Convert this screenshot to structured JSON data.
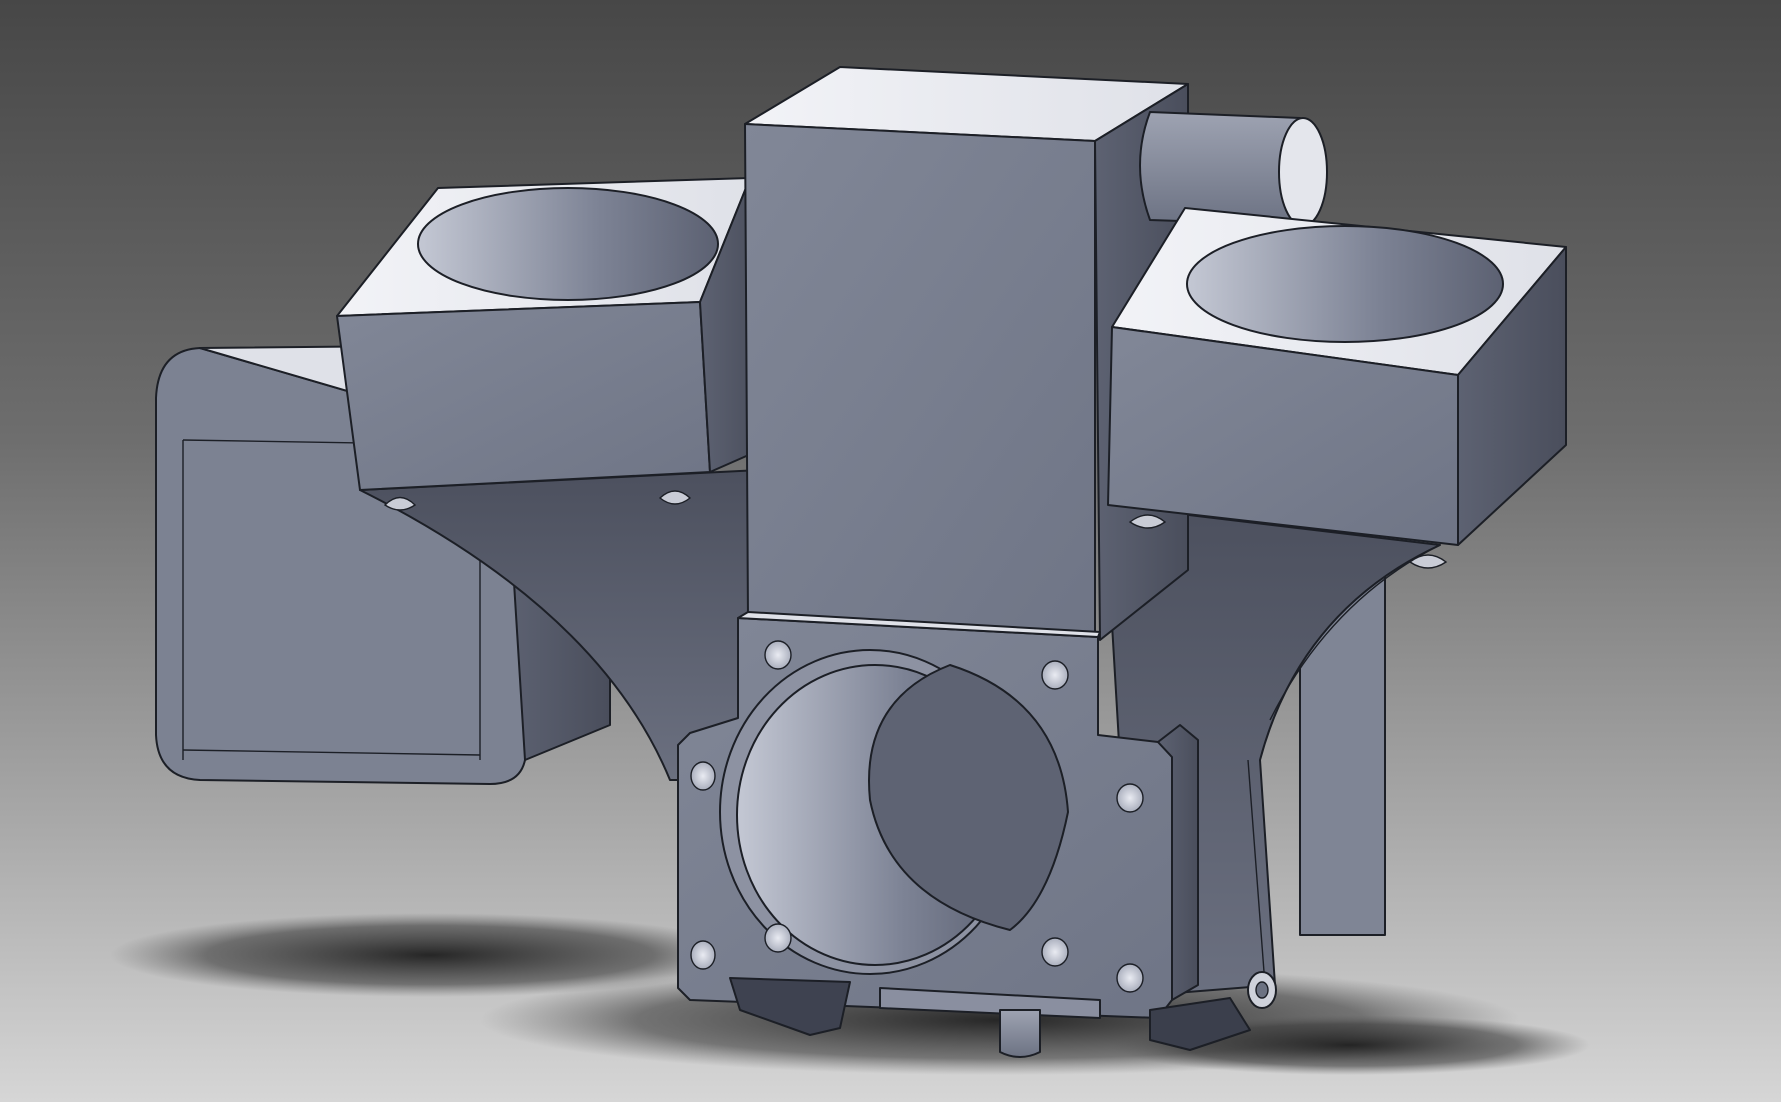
{
  "viewport": {
    "background_top": "#474747",
    "background_bottom": "#d6d6d6",
    "model_color": "#7e8496"
  }
}
